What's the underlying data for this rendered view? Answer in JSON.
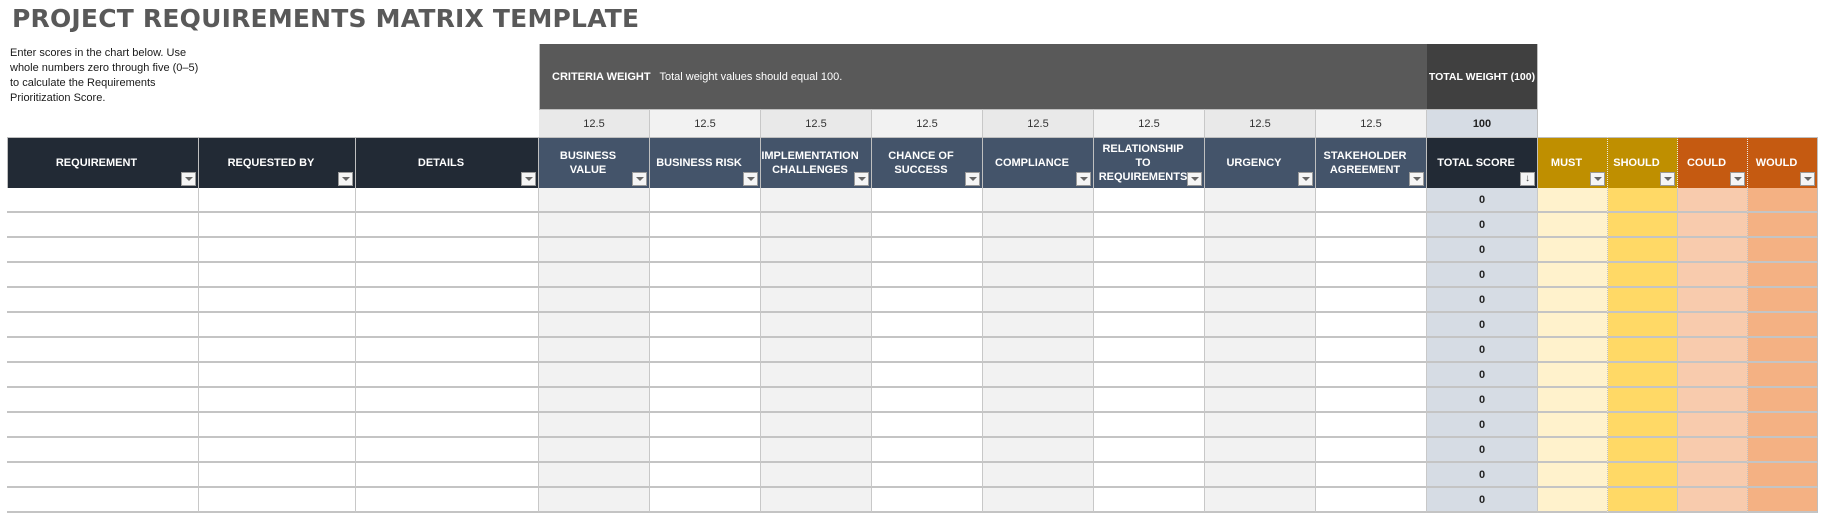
{
  "title": "PROJECT REQUIREMENTS MATRIX TEMPLATE",
  "instructions": "Enter scores in the chart below. Use whole numbers zero through five (0–5) to calculate the Requirements Prioritization Score.",
  "criteria_band": {
    "label": "CRITERIA WEIGHT",
    "note": "Total weight values should equal 100.",
    "total_label": "TOTAL WEIGHT (100)"
  },
  "weights": [
    "12.5",
    "12.5",
    "12.5",
    "12.5",
    "12.5",
    "12.5",
    "12.5",
    "12.5"
  ],
  "total_weight": "100",
  "columns": [
    {
      "key": "requirement",
      "label": "REQUIREMENT"
    },
    {
      "key": "requested_by",
      "label": "REQUESTED BY"
    },
    {
      "key": "details",
      "label": "DETAILS"
    },
    {
      "key": "business_value",
      "label": "BUSINESS VALUE"
    },
    {
      "key": "business_risk",
      "label": "BUSINESS RISK"
    },
    {
      "key": "implementation_challenges",
      "label": "IMPLEMENTATION CHALLENGES"
    },
    {
      "key": "chance_of_success",
      "label": "CHANCE OF SUCCESS"
    },
    {
      "key": "compliance",
      "label": "COMPLIANCE"
    },
    {
      "key": "relationship_to_requirements",
      "label": "RELATIONSHIP TO REQUIREMENTS"
    },
    {
      "key": "urgency",
      "label": "URGENCY"
    },
    {
      "key": "stakeholder_agreement",
      "label": "STAKEHOLDER AGREEMENT"
    },
    {
      "key": "total_score",
      "label": "TOTAL SCORE"
    },
    {
      "key": "must",
      "label": "MUST"
    },
    {
      "key": "should",
      "label": "SHOULD"
    },
    {
      "key": "could",
      "label": "COULD"
    },
    {
      "key": "would",
      "label": "WOULD"
    }
  ],
  "rows": [
    {
      "total_score": "0"
    },
    {
      "total_score": "0"
    },
    {
      "total_score": "0"
    },
    {
      "total_score": "0"
    },
    {
      "total_score": "0"
    },
    {
      "total_score": "0"
    },
    {
      "total_score": "0"
    },
    {
      "total_score": "0"
    },
    {
      "total_score": "0"
    },
    {
      "total_score": "0"
    },
    {
      "total_score": "0"
    },
    {
      "total_score": "0"
    },
    {
      "total_score": "0"
    }
  ],
  "colors": {
    "header_dark": "#222a35",
    "header_slate": "#44546a",
    "must_should_header": "#bf8f00",
    "could_would_header": "#c55a11",
    "must_fill": "#fff2cc",
    "should_fill": "#ffd966",
    "could_fill": "#f8cbad",
    "would_fill": "#f4b183",
    "total_fill": "#d6dce4"
  }
}
